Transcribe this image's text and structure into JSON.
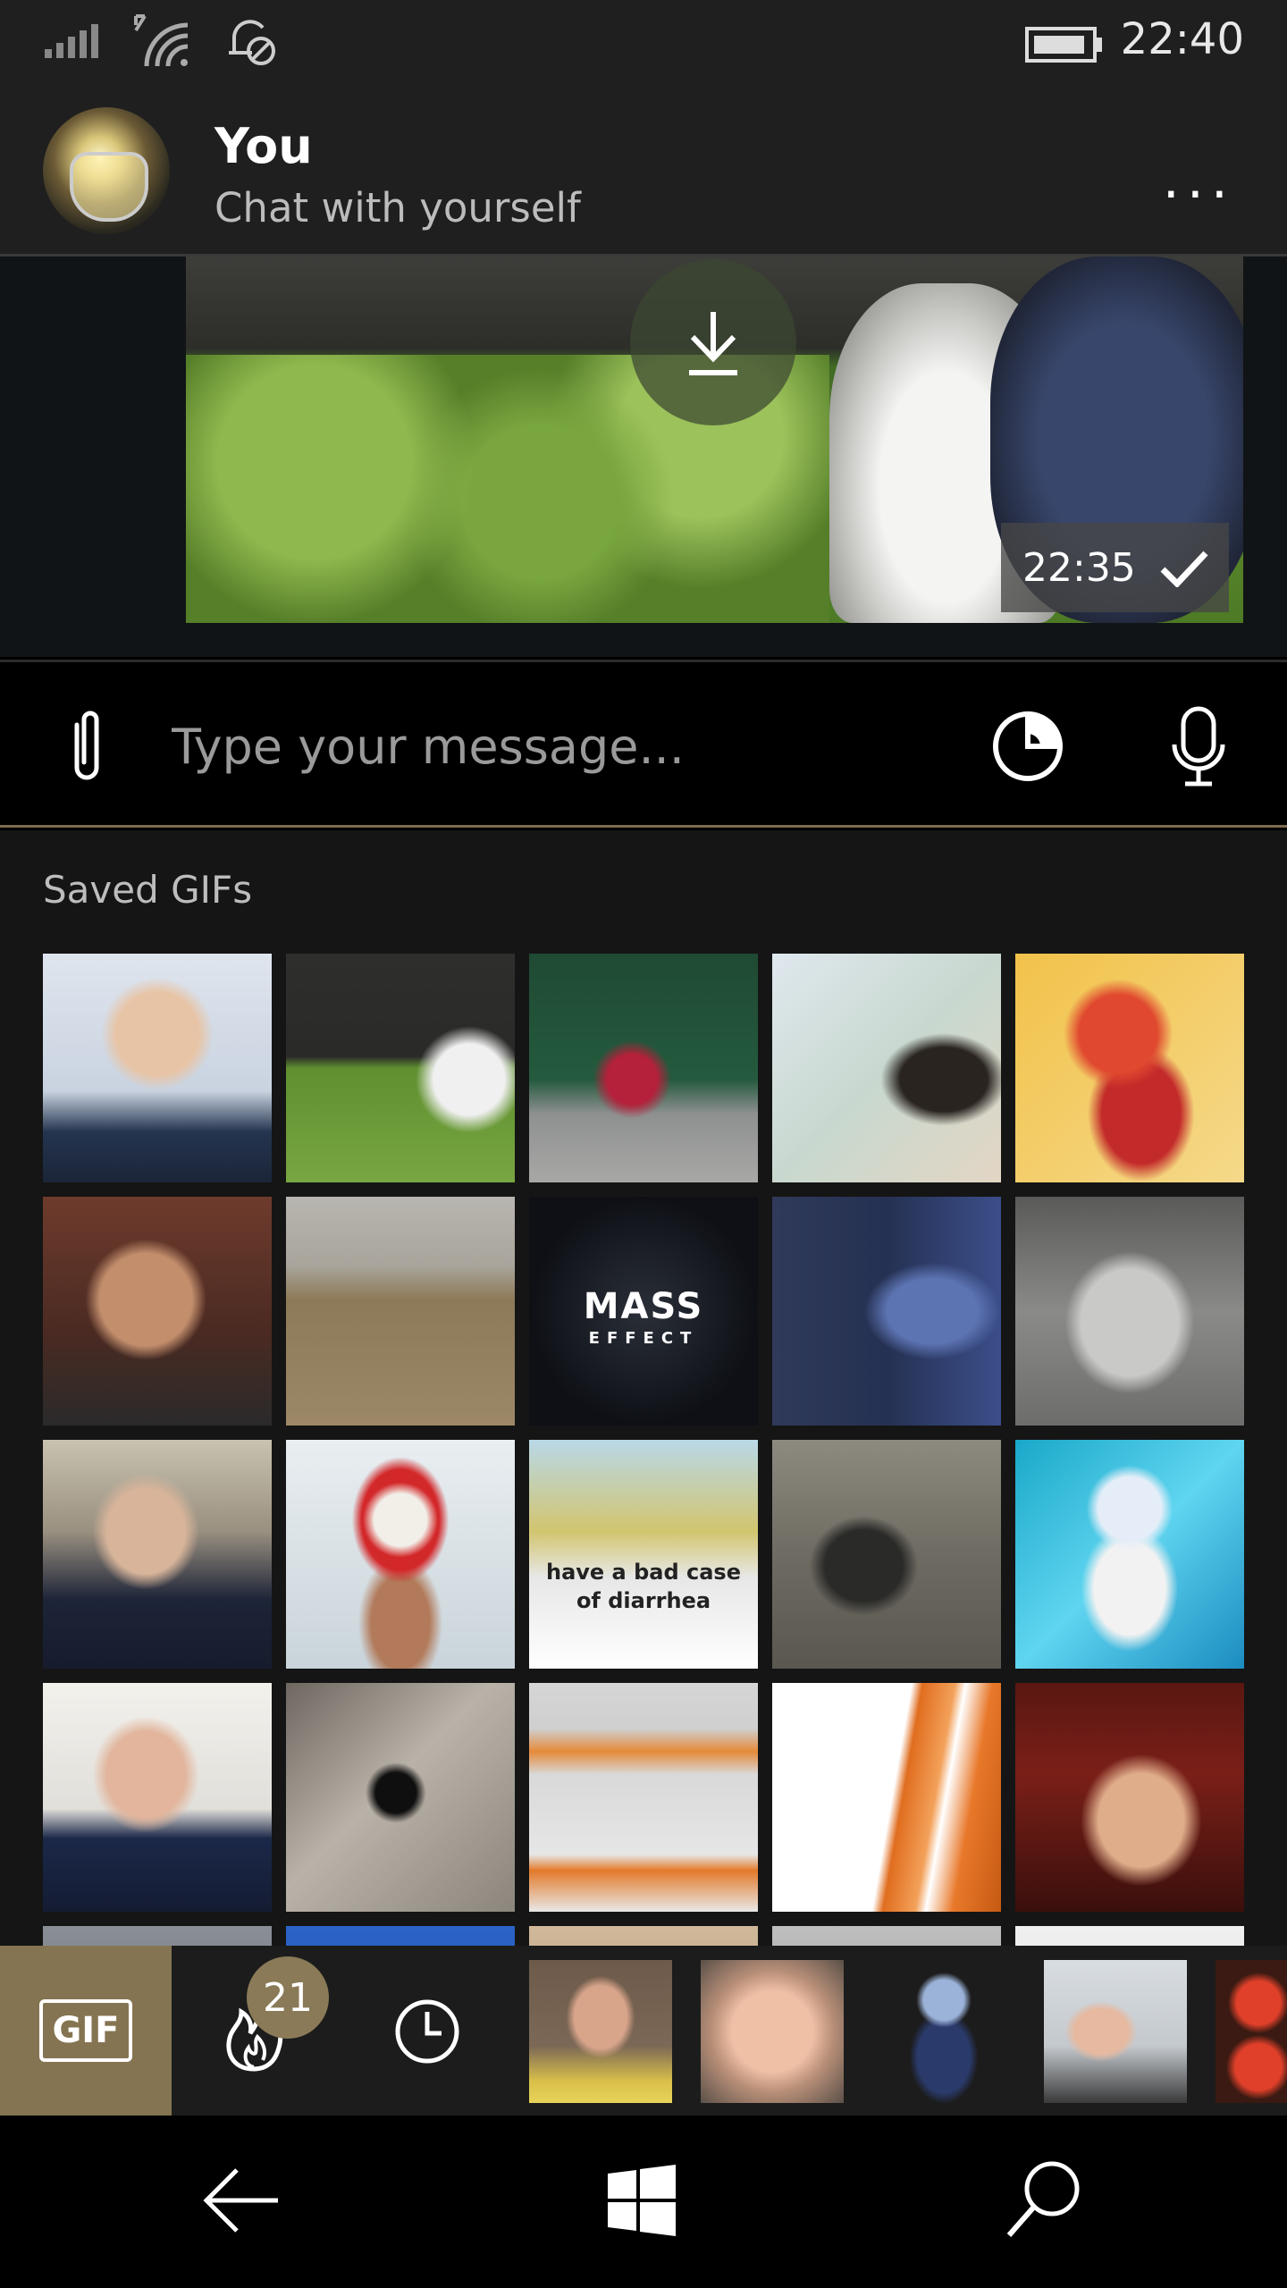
{
  "status": {
    "time": "22:40"
  },
  "chat": {
    "title": "You",
    "subtitle": "Chat with yourself",
    "more": "..."
  },
  "message": {
    "time": "22:35"
  },
  "input": {
    "placeholder": "Type your message..."
  },
  "panel": {
    "title": "Saved GIFs"
  },
  "gif_texts": {
    "mass": "MASS",
    "mass_sub": "EFFECT",
    "diarrhea": "have a bad case of diarrhea"
  },
  "tabs": {
    "gif_label": "GIF",
    "trending_count": "21"
  },
  "colors": {
    "accent": "#857451",
    "badge": "#8a7a58"
  }
}
